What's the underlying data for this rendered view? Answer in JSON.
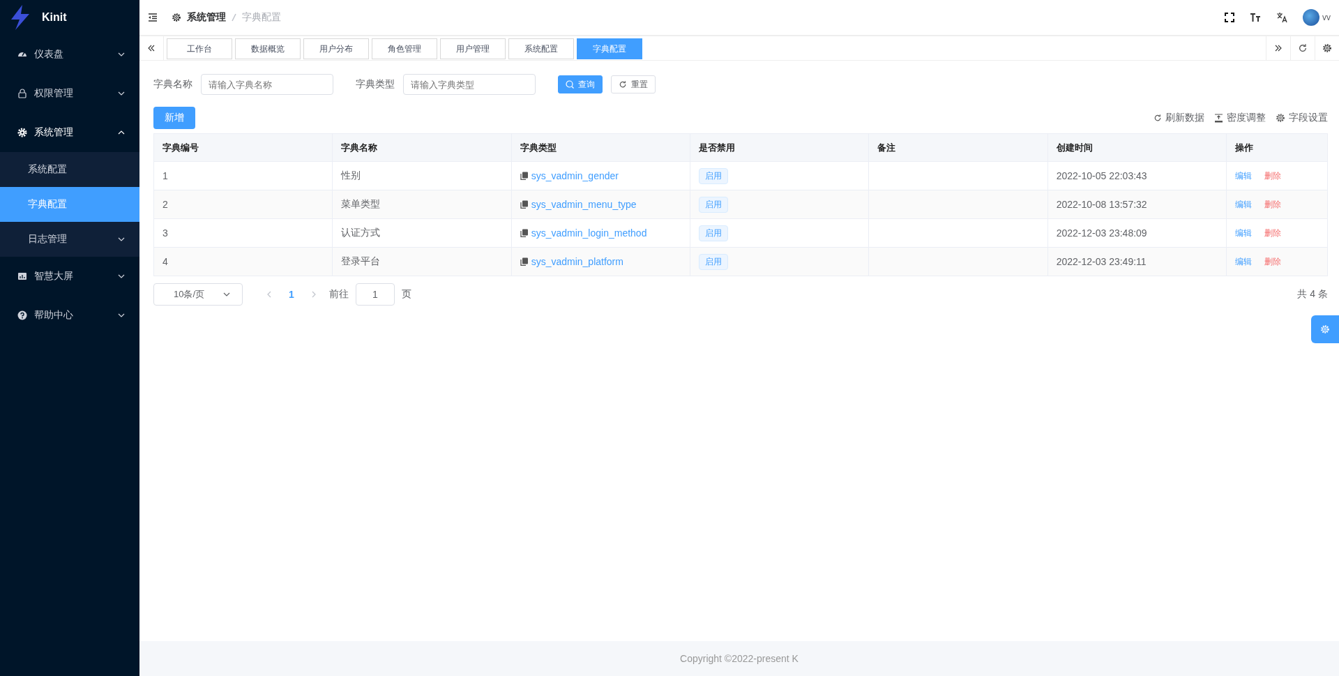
{
  "sidebar": {
    "logo_text": "Kinit",
    "items": [
      {
        "label": "仪表盘",
        "expanded": false
      },
      {
        "label": "权限管理",
        "expanded": false
      },
      {
        "label": "系统管理",
        "expanded": true,
        "children": [
          {
            "label": "系统配置",
            "selected": false
          },
          {
            "label": "字典配置",
            "selected": true
          },
          {
            "label": "日志管理",
            "selected": false,
            "expanded": false
          }
        ]
      },
      {
        "label": "智慧大屏",
        "expanded": false
      },
      {
        "label": "帮助中心",
        "expanded": false
      }
    ]
  },
  "header": {
    "breadcrumb": [
      "系统管理",
      "字典配置"
    ],
    "user": "vv"
  },
  "tabs": [
    {
      "label": "工作台",
      "selected": false
    },
    {
      "label": "数据概览",
      "selected": false
    },
    {
      "label": "用户分布",
      "selected": false
    },
    {
      "label": "角色管理",
      "selected": false
    },
    {
      "label": "用户管理",
      "selected": false
    },
    {
      "label": "系统配置",
      "selected": false
    },
    {
      "label": "字典配置",
      "selected": true
    }
  ],
  "filters": [
    {
      "label": "字典名称",
      "placeholder": "请输入字典名称"
    },
    {
      "label": "字典类型",
      "placeholder": "请输入字典类型"
    }
  ],
  "search_button": "查询",
  "reset_button": "重置",
  "add_button": "新增",
  "toolbar": [
    "刷新数据",
    "密度调整",
    "字段设置"
  ],
  "table": {
    "columns": [
      "字典编号",
      "字典名称",
      "字典类型",
      "是否禁用",
      "备注",
      "创建时间",
      "操作"
    ],
    "rows": [
      {
        "id": "1",
        "name": "性别",
        "type": "sys_vadmin_gender",
        "status": "启用",
        "created": "2022-10-05 22:03:43",
        "edit": "编辑",
        "delete": "删除"
      },
      {
        "id": "2",
        "name": "菜单类型",
        "type": "sys_vadmin_menu_type",
        "status": "启用",
        "created": "2022-10-08 13:57:32",
        "edit": "编辑",
        "delete": "删除"
      },
      {
        "id": "3",
        "name": "认证方式",
        "type": "sys_vadmin_login_method",
        "status": "启用",
        "created": "2022-12-03 23:48:09",
        "edit": "编辑",
        "delete": "删除"
      },
      {
        "id": "4",
        "name": "登录平台",
        "type": "sys_vadmin_platform",
        "status": "启用",
        "created": "2022-12-03 23:49:11",
        "edit": "编辑",
        "delete": "删除"
      }
    ]
  },
  "pagination": {
    "page_size": "10条/页",
    "current_page": "1",
    "goto_label": "前往",
    "goto_value": "1",
    "page_suffix": "页",
    "total": "共 4 条"
  },
  "footer": "Copyright ©2022-present K"
}
